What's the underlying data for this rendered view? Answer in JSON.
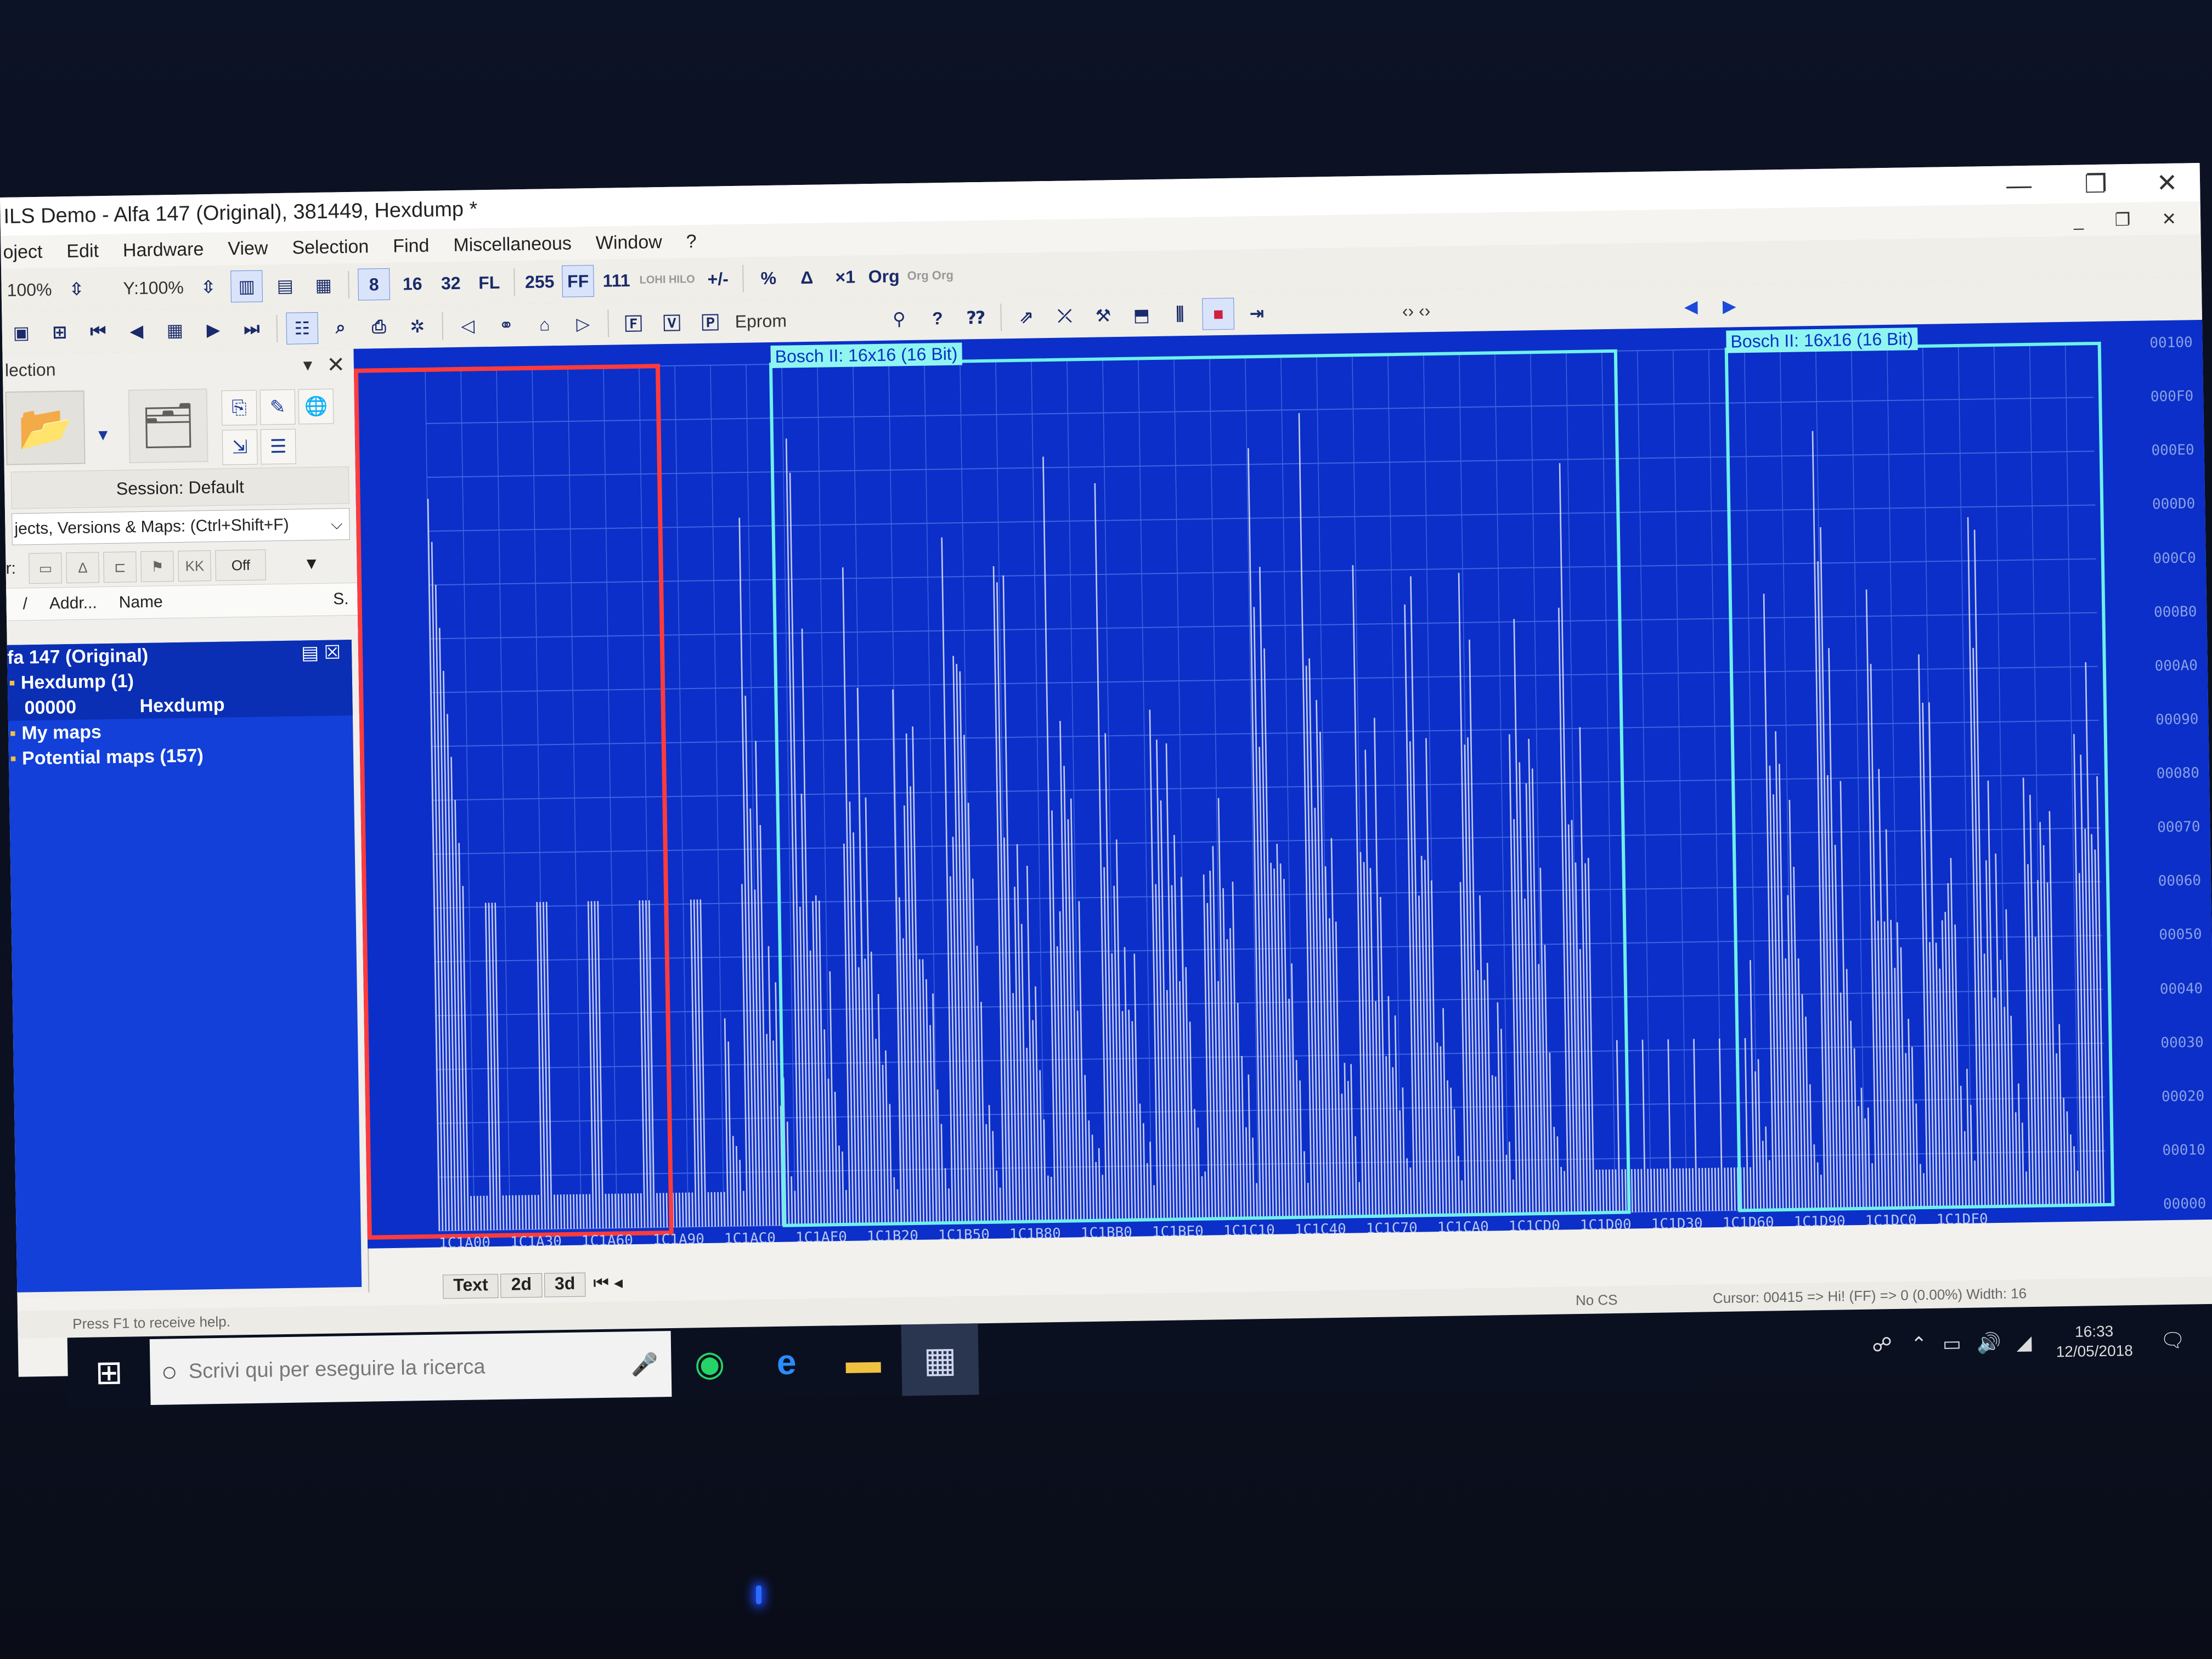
{
  "window": {
    "title": "ILS Demo - Alfa 147 (Original), 381449, Hexdump *",
    "controls": {
      "minimize": "—",
      "restore": "❐",
      "close": "✕"
    }
  },
  "menu": [
    "oject",
    "Edit",
    "Hardware",
    "View",
    "Selection",
    "Find",
    "Miscellaneous",
    "Window",
    "?"
  ],
  "mdi_controls": "_ ❐ ✕",
  "toolbar1": {
    "zoom_x": "100%",
    "zoom_y": "Y:100%",
    "bits": [
      "8",
      "16",
      "32",
      "FL"
    ],
    "values": [
      "255",
      "FF",
      "111",
      "LOHI HILO",
      "+/-",
      "%",
      "Δ",
      "×1",
      "Org",
      "Org Org"
    ]
  },
  "toolbar2": {
    "mode_label": "Eprom",
    "arrows": "‹› ‹›"
  },
  "left_panel": {
    "title": "lection",
    "session": "Session: Default",
    "search_label": "jects, Versions & Maps:  (Ctrl+Shift+F)",
    "filter_prefix": "r:",
    "filter_off": "Off",
    "columns": {
      "slash": "/",
      "addr": "Addr...",
      "name": "Name",
      "s": "S."
    },
    "tree": [
      {
        "text": "fa 147 (Original)",
        "indent": 0
      },
      {
        "text": "Hexdump (1)",
        "indent": 1
      },
      {
        "addr": "00000",
        "name": "Hexdump",
        "indent": 2
      },
      {
        "text": "My maps",
        "indent": 1
      },
      {
        "text": "Potential maps (157)",
        "indent": 1
      }
    ]
  },
  "graph": {
    "map_labels": [
      "Bosch II: 16x16 (16 Bit)",
      "Bosch II: 16x16 (16 Bit)"
    ],
    "y_labels": [
      "00100",
      "000F0",
      "000E0",
      "000D0",
      "000C0",
      "000B0",
      "000A0",
      "00090",
      "00080",
      "00070",
      "00060",
      "00050",
      "00040",
      "00030",
      "00020",
      "00010",
      "00000"
    ],
    "x_labels": [
      "1C1A00",
      "1C1A30",
      "1C1A60",
      "1C1A90",
      "1C1AC0",
      "1C1AF0",
      "1C1B20",
      "1C1B50",
      "1C1B80",
      "1C1BB0",
      "1C1BE0",
      "1C1C10",
      "1C1C40",
      "1C1C70",
      "1C1CA0",
      "1C1CD0",
      "1C1D00",
      "1C1D30",
      "1C1D60",
      "1C1D90",
      "1C1DC0",
      "1C1DF0"
    ],
    "colors": {
      "background": "#0b2fc8",
      "grid": "#3f63e0",
      "bars": "#d8dcf5",
      "selection": "#ff3b3b",
      "map_border": "#6ff0e8"
    }
  },
  "view_tabs": [
    "Text",
    "2d",
    "3d"
  ],
  "status": {
    "help": "Press F1 to receive help.",
    "cs": "No CS",
    "cursor": "Cursor: 00415 => Hi! (FF) => 0 (0.00%)   Width: 16"
  },
  "taskbar": {
    "search_placeholder": "Scrivi qui per eseguire la ricerca",
    "time": "16:33",
    "date": "12/05/2018"
  }
}
